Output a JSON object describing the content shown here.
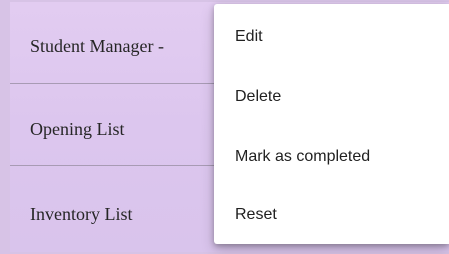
{
  "list": {
    "items": [
      {
        "label": "Student Manager -"
      },
      {
        "label": "Opening List"
      },
      {
        "label": "Inventory List"
      }
    ]
  },
  "context_menu": {
    "items": [
      {
        "label": "Edit"
      },
      {
        "label": "Delete"
      },
      {
        "label": "Mark as completed"
      },
      {
        "label": "Reset"
      }
    ]
  },
  "colors": {
    "list_background": "#dcc6ee",
    "divider": "#a89bb4",
    "menu_background": "#ffffff",
    "text": "#212121"
  }
}
